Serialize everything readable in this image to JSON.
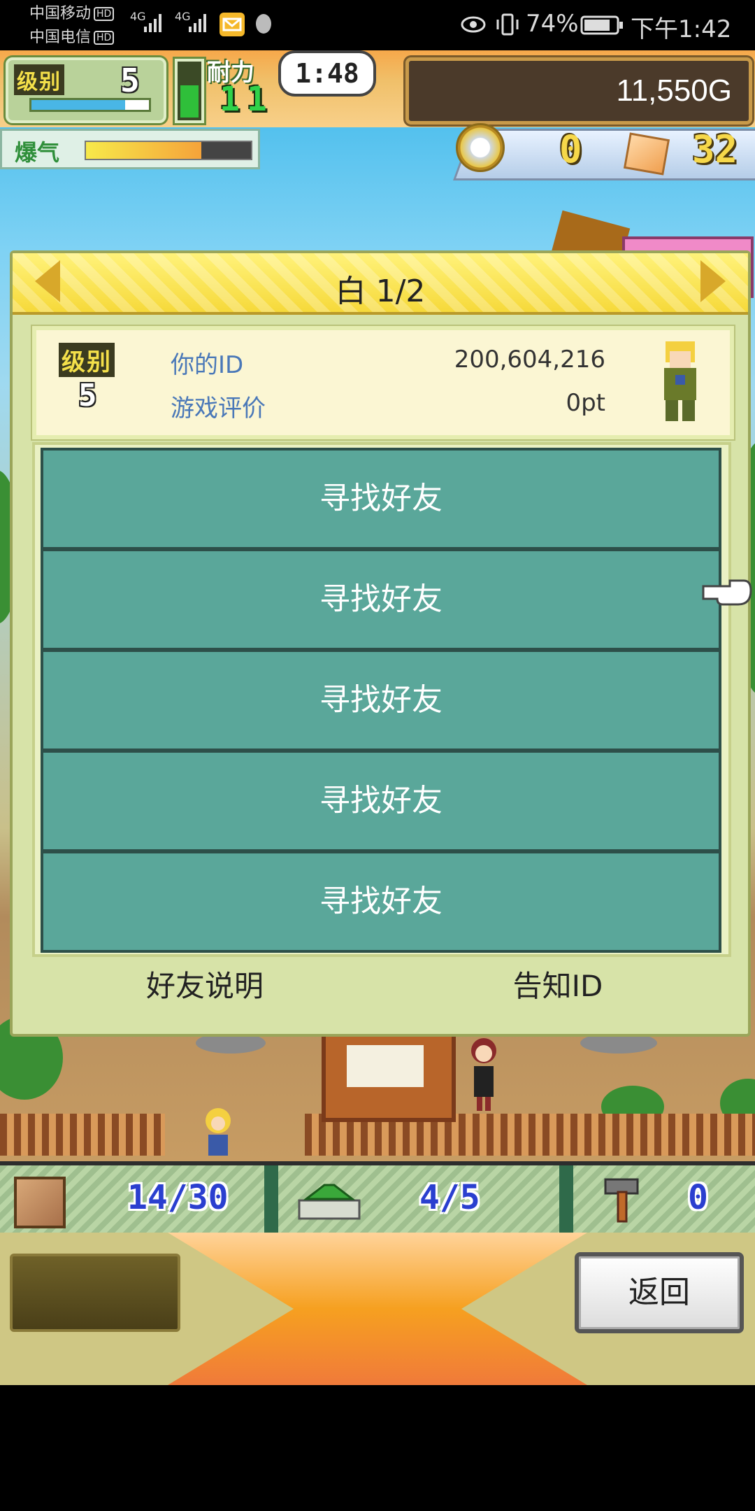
{
  "status_bar": {
    "carrier1": "中国移动",
    "carrier2": "中国电信",
    "hd": "HD",
    "network": "4G",
    "battery": "74%",
    "time": "下午1:42"
  },
  "hud": {
    "level_label": "级别",
    "level": "5",
    "stamina_label": "耐力",
    "stamina": "11",
    "timer": "1:48",
    "gold": "11,550G",
    "boost_label": "爆气",
    "medals": "0",
    "gems": "32"
  },
  "dialog": {
    "title": "白 1/2",
    "profile": {
      "level_label": "级别",
      "level": "5",
      "id_label": "你的ID",
      "id_value": "200,604,216",
      "rating_label": "游戏评价",
      "rating_value": "0pt"
    },
    "friend_slots": [
      "寻找好友",
      "寻找好友",
      "寻找好友",
      "寻找好友",
      "寻找好友"
    ],
    "footer_left": "好友说明",
    "footer_right": "告知ID"
  },
  "bottom": {
    "stat1": "14/30",
    "stat2": "4/5",
    "stat3": "0",
    "back_label": "返回"
  },
  "icons": [
    "prev-arrow-icon",
    "next-arrow-icon",
    "medal-icon",
    "gem-icon",
    "pointer-hand-icon",
    "crate-icon",
    "plane-icon",
    "hammer-icon"
  ],
  "levels": {
    "exp_fraction": 0.8,
    "stamina_fraction": 0.55,
    "boost_fraction": 0.7
  },
  "colors": {
    "friend_slot": "#5aa79a",
    "header": "#f6d93a",
    "gold_box": "#4b3a2a"
  }
}
